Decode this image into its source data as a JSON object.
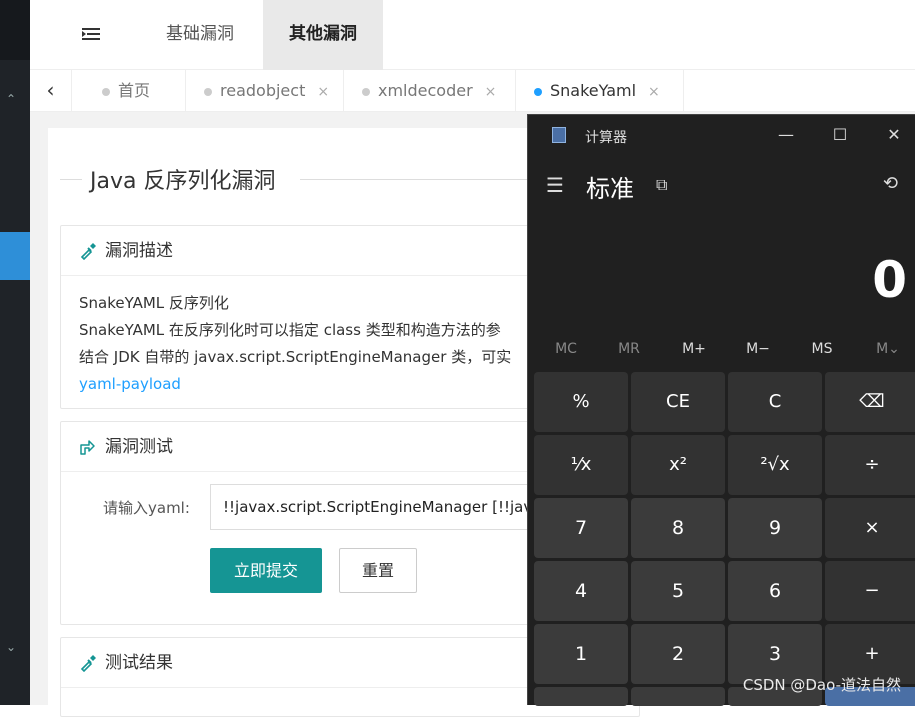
{
  "topnav": {
    "items": [
      {
        "label": "基础漏洞"
      },
      {
        "label": "其他漏洞"
      }
    ]
  },
  "tabs": [
    {
      "label": "首页"
    },
    {
      "label": "readobject"
    },
    {
      "label": "xmldecoder"
    },
    {
      "label": "SnakeYaml"
    }
  ],
  "tab_close": "×",
  "page": {
    "title": "Java 反序列化漏洞"
  },
  "desc_card": {
    "heading": "漏洞描述",
    "line1": "SnakeYAML 反序列化",
    "line2": "SnakeYAML 在反序列化时可以指定 class 类型和构造方法的参",
    "line3": "结合 JDK 自带的 javax.script.ScriptEngineManager 类，可实",
    "link": "yaml-payload"
  },
  "test_card": {
    "heading": "漏洞测试",
    "label": "请输入yaml:",
    "input_value": "!!javax.script.ScriptEngineManager [!!javax",
    "submit": "立即提交",
    "reset": "重置"
  },
  "result_card": {
    "heading": "测试结果"
  },
  "calculator": {
    "title": "计算器",
    "mode": "标准",
    "display": "0",
    "memory": [
      "MC",
      "MR",
      "M+",
      "M−",
      "MS",
      "M⌄"
    ],
    "rows": [
      [
        "%",
        "CE",
        "C",
        "⌫"
      ],
      [
        "¹⁄x",
        "x²",
        "²√x",
        "÷"
      ],
      [
        "7",
        "8",
        "9",
        "×"
      ],
      [
        "4",
        "5",
        "6",
        "−"
      ],
      [
        "1",
        "2",
        "3",
        "+"
      ]
    ]
  },
  "watermark": "CSDN @Dao-道法自然",
  "colors": {
    "accent": "#159594",
    "link": "#1e9fff",
    "calc_bg": "#202020"
  }
}
